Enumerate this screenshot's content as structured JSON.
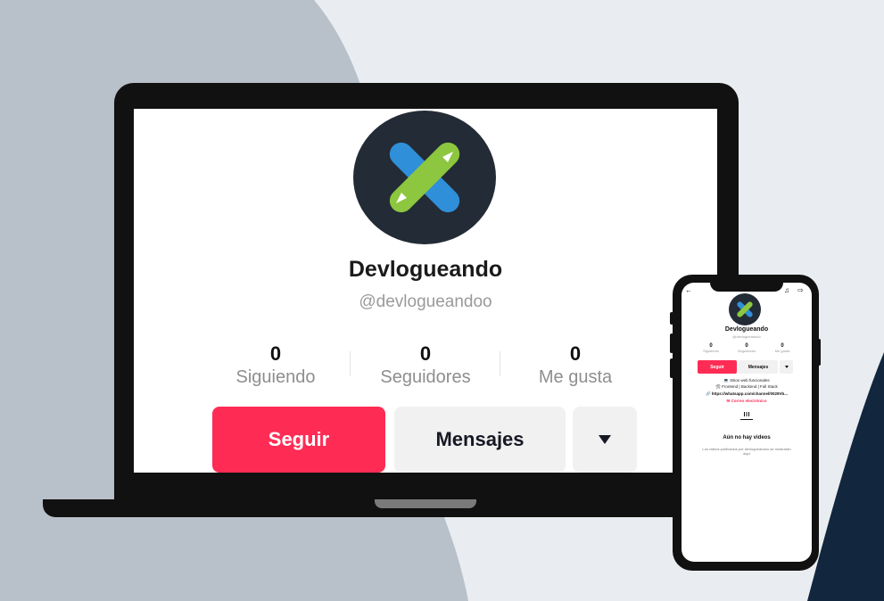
{
  "laptop_profile": {
    "display_name": "Devlogueando",
    "handle": "@devlogueandoo",
    "stats": [
      {
        "value": "0",
        "label": "Siguiendo"
      },
      {
        "value": "0",
        "label": "Seguidores"
      },
      {
        "value": "0",
        "label": "Me gusta"
      }
    ],
    "follow_label": "Seguir",
    "message_label": "Mensajes"
  },
  "phone_profile": {
    "display_name": "Devlogueando",
    "handle": "@devlogueandoo",
    "stats": [
      {
        "value": "0",
        "label": "Siguiendo"
      },
      {
        "value": "0",
        "label": "Seguidores"
      },
      {
        "value": "0",
        "label": "Me gusta"
      }
    ],
    "follow_label": "Seguir",
    "message_label": "Mensajes",
    "bio_line_1": "💻 Sitios web funcionales",
    "bio_line_2": "🛠 Frontend | Backend | Full Stack",
    "link": "🔗 https://whatsapp.com/channel/0029Vb...",
    "email_link": "✉ Correo electrónico",
    "empty_title": "Aún no hay videos",
    "empty_subtitle": "Los videos publicados por devlogueandoo se mostrarán aquí"
  },
  "colors": {
    "accent": "#fe2c55",
    "background": "#e9edf1",
    "blob_gray": "#b8c0c9",
    "navy": "#12263d"
  },
  "icons": {
    "avatar_logo": "x-logo",
    "dropdown": "triangle-down-icon",
    "back": "arrow-left-icon",
    "bell": "bell-icon",
    "share": "share-icon"
  }
}
